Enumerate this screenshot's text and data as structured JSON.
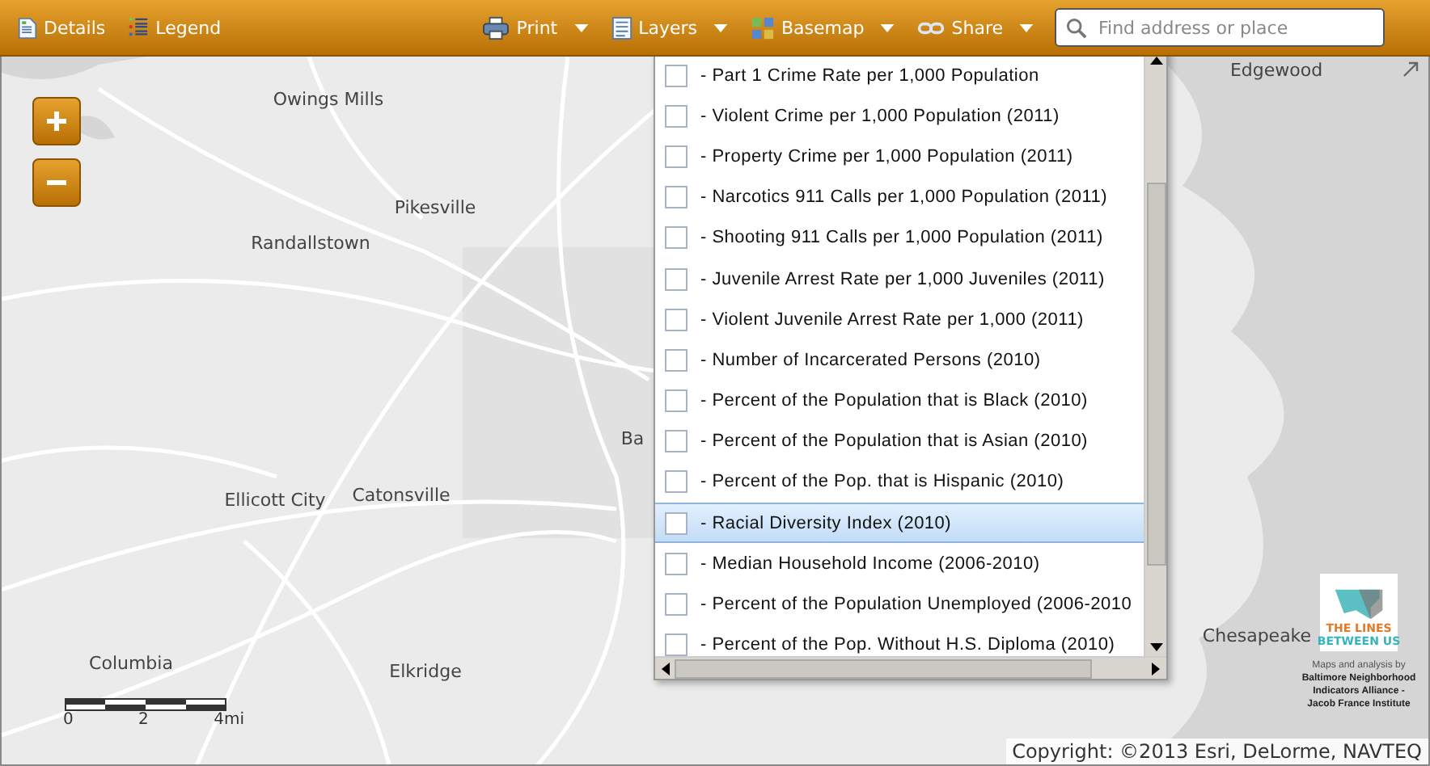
{
  "toolbar": {
    "left": [
      {
        "kind": "details",
        "label": "Details"
      },
      {
        "kind": "legend",
        "label": "Legend"
      }
    ],
    "right": [
      {
        "kind": "print",
        "label": "Print"
      },
      {
        "kind": "layers",
        "label": "Layers"
      },
      {
        "kind": "basemap",
        "label": "Basemap"
      },
      {
        "kind": "share",
        "label": "Share"
      }
    ],
    "search": {
      "placeholder": "Find address or place"
    }
  },
  "map": {
    "places": [
      "Edgewood",
      "Owings Mills",
      "Pikesville",
      "Randallstown",
      "Ba",
      "Ellicott City",
      "Catonsville",
      "Chesapeake",
      "Columbia",
      "Elkridge"
    ],
    "scale_labels": [
      "0",
      "2",
      "4mi"
    ],
    "logo": {
      "line_1": "THE LINES",
      "line_2": "BETWEEN US"
    },
    "credits": [
      "Maps and analysis by",
      "Baltimore Neighborhood",
      "Indicators Alliance -",
      "Jacob France Institute"
    ],
    "copyright": "Copyright: ©2013 Esri, DeLorme, NAVTEQ"
  },
  "layers": [
    {
      "label": "- Part 1 Crime Rate per 1,000 Population",
      "checked": false,
      "selected": false
    },
    {
      "label": "- Violent Crime per 1,000 Population (2011)",
      "checked": false,
      "selected": false
    },
    {
      "label": "- Property Crime per 1,000 Population (2011)",
      "checked": false,
      "selected": false
    },
    {
      "label": "- Narcotics 911 Calls per 1,000 Population (2011)",
      "checked": false,
      "selected": false
    },
    {
      "label": "- Shooting 911 Calls per 1,000 Population (2011)",
      "checked": false,
      "selected": false
    },
    {
      "label": "- Juvenile Arrest Rate per 1,000 Juveniles (2011)",
      "checked": false,
      "selected": false
    },
    {
      "label": "- Violent Juvenile Arrest Rate per 1,000 (2011)",
      "checked": false,
      "selected": false
    },
    {
      "label": "- Number of Incarcerated Persons (2010)",
      "checked": false,
      "selected": false
    },
    {
      "label": "- Percent of the Population that is Black (2010)",
      "checked": false,
      "selected": false
    },
    {
      "label": "- Percent of the Population that is Asian (2010)",
      "checked": false,
      "selected": false
    },
    {
      "label": "- Percent of the Pop. that is Hispanic (2010)",
      "checked": false,
      "selected": false
    },
    {
      "label": "- Racial Diversity Index (2010)",
      "checked": false,
      "selected": true
    },
    {
      "label": "- Median Household Income (2006-2010)",
      "checked": false,
      "selected": false
    },
    {
      "label": "- Percent of the Population Unemployed (2006-2010",
      "checked": false,
      "selected": false
    },
    {
      "label": "- Percent of the Pop. Without H.S. Diploma (2010)",
      "checked": false,
      "selected": false
    }
  ]
}
